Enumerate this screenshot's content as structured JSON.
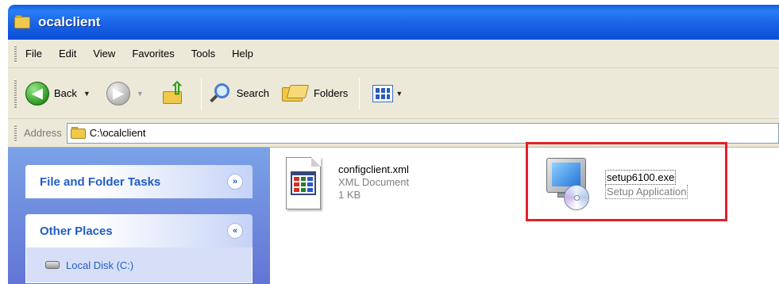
{
  "window": {
    "title": "ocalclient"
  },
  "menu": {
    "items": [
      "File",
      "Edit",
      "View",
      "Favorites",
      "Tools",
      "Help"
    ]
  },
  "toolbar": {
    "back_label": "Back",
    "search_label": "Search",
    "folders_label": "Folders"
  },
  "address": {
    "label": "Address",
    "path": "C:\\ocalclient"
  },
  "sidebar": {
    "file_tasks_title": "File and Folder Tasks",
    "other_places_title": "Other Places",
    "places": [
      "Local Disk (C:)"
    ]
  },
  "files": [
    {
      "name": "configclient.xml",
      "type": "XML Document",
      "size": "1 KB",
      "icon": "xml-document-icon"
    },
    {
      "name": "setup6100.exe",
      "type": "Setup Application",
      "icon": "setup-application-icon",
      "selected": true
    }
  ],
  "colors": {
    "titlebar": "#0b4fd6",
    "highlight": "#e2202b",
    "task_title": "#215dc6",
    "sidepanel": "#6e8cdc"
  }
}
